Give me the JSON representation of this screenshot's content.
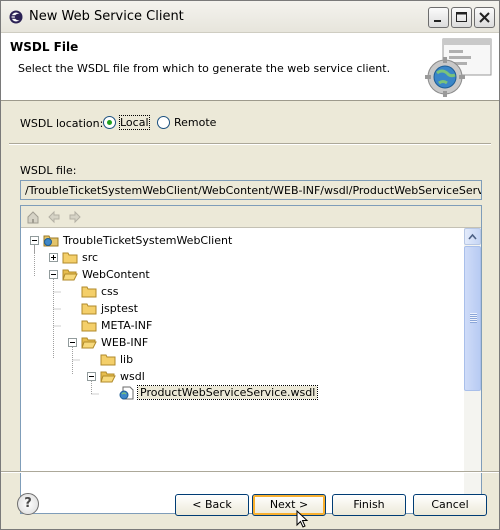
{
  "window": {
    "title": "New Web Service Client",
    "icon": "eclipse-icon"
  },
  "banner": {
    "title": "WSDL File",
    "description": "Select the WSDL file from which to generate the web service client.",
    "image": "web-service-globe-image"
  },
  "location": {
    "label": "WSDL location:",
    "options": [
      {
        "label": "Local",
        "selected": true
      },
      {
        "label": "Remote",
        "selected": false
      }
    ]
  },
  "wsdl_file": {
    "label": "WSDL file:",
    "value": "/TroubleTicketSystemWebClient/WebContent/WEB-INF/wsdl/ProductWebServiceService.wsdl"
  },
  "tree": {
    "toolbar_icons": [
      "home-icon",
      "back-arrow-icon",
      "forward-arrow-icon"
    ],
    "items": [
      {
        "label": "TroubleTicketSystemWebClient",
        "type": "project",
        "expanded": true
      },
      {
        "label": "src",
        "type": "folder",
        "expanded": false
      },
      {
        "label": "WebContent",
        "type": "folder",
        "expanded": true
      },
      {
        "label": "css",
        "type": "folder"
      },
      {
        "label": "jsptest",
        "type": "folder"
      },
      {
        "label": "META-INF",
        "type": "folder"
      },
      {
        "label": "WEB-INF",
        "type": "folder",
        "expanded": true
      },
      {
        "label": "lib",
        "type": "folder"
      },
      {
        "label": "wsdl",
        "type": "folder",
        "expanded": true
      },
      {
        "label": "ProductWebServiceService.wsdl",
        "type": "wsdl-file",
        "selected": true
      }
    ]
  },
  "buttons": {
    "help": "?",
    "back": "< Back",
    "next": "Next >",
    "finish": "Finish",
    "cancel": "Cancel"
  }
}
